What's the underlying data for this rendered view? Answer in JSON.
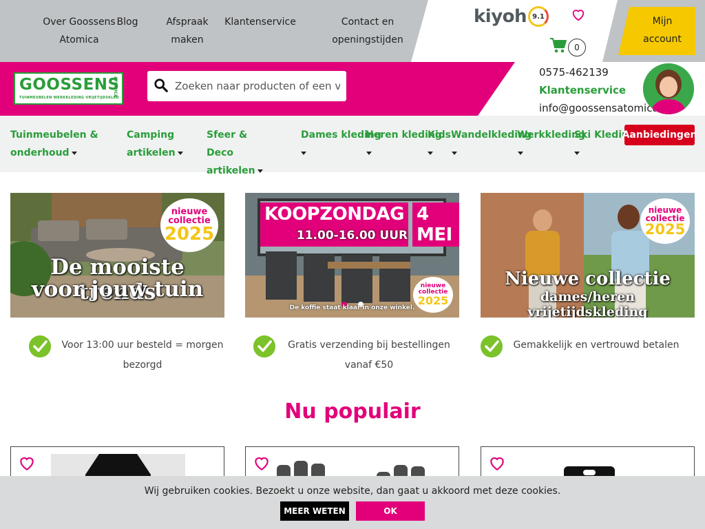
{
  "topbar": {
    "links": [
      {
        "label": "Over Goossens Atomica"
      },
      {
        "label": "Blog"
      },
      {
        "label": "Afspraak maken"
      },
      {
        "label": "Klantenservice"
      },
      {
        "label": "Contact en openingstijden"
      }
    ],
    "kiyoh_brand": "kiyoh",
    "kiyoh_score": "9.1",
    "cart_count": "0",
    "account_label": "Mijn account"
  },
  "header": {
    "logo_text": "GOOSSENS",
    "logo_sub": "TUINMEUBELEN WERKKLEDING VRIJETIJDSKLEDING",
    "logo_side": "ATOMICA",
    "search_placeholder": "Zoeken naar producten of een veld",
    "phone": "0575-462139",
    "service_label": "Klantenservice",
    "email": "info@goossensatomica.nl"
  },
  "mainnav": {
    "items": [
      {
        "label": "Tuinmeubelen & onderhoud"
      },
      {
        "label": "Camping artikelen"
      },
      {
        "label": "Sfeer & Deco artikelen"
      },
      {
        "label": "Dames kleding"
      },
      {
        "label": "Heren kleding"
      },
      {
        "label": "Kids"
      },
      {
        "label": "Wandelkleding"
      },
      {
        "label": "Werkkleding"
      },
      {
        "label": "Ski Kleding"
      }
    ],
    "offers_label": "Aanbiedingen"
  },
  "banners": [
    {
      "headline_1": "De mooiste trends",
      "headline_2": "voor jouw tuin",
      "sticker_1": "nieuwe",
      "sticker_2": "collectie",
      "sticker_3": "2025"
    },
    {
      "title_a": "KOOPZONDAG",
      "title_b": "4 MEI",
      "time": "11.00-16.00 UUR",
      "footer": "De koffie staat klaar in onze winkel.",
      "sticker_1": "nieuwe",
      "sticker_2": "collectie",
      "sticker_3": "2025"
    },
    {
      "headline_1": "Nieuwe collectie",
      "headline_2": "dames/heren vrijetijdskleding",
      "sticker_1": "nieuwe",
      "sticker_2": "collectie",
      "sticker_3": "2025"
    }
  ],
  "usps": [
    {
      "line_1": "Voor 13:00 uur besteld = morgen",
      "line_2": "bezorgd"
    },
    {
      "line_1": "Gratis verzending bij bestellingen",
      "line_2": "vanaf €50"
    },
    {
      "line_1": "Gemakkelijk en vertrouwd betalen",
      "line_2": ""
    }
  ],
  "popular": {
    "title": "Nu populair"
  },
  "cookie": {
    "message": "Wij gebruiken cookies. Bezoekt u onze website, dan gaat u akkoord met deze cookies.",
    "more_label": "MEER WETEN",
    "ok_label": "OK"
  },
  "colors": {
    "magenta": "#e2007a",
    "green": "#2a9d3a",
    "yellow": "#f5c800",
    "red": "#d6001c",
    "check": "#7cc22a"
  }
}
